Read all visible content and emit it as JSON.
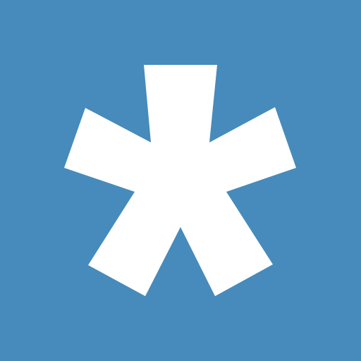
{
  "icon": {
    "name": "asterisk-icon",
    "background_color": "#468BBB",
    "glyph_color": "#FFFFFF"
  }
}
